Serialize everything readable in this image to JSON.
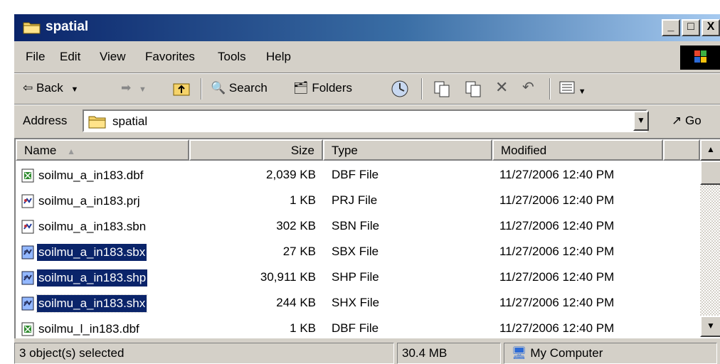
{
  "window": {
    "title": "spatial",
    "controls": {
      "minimize": "_",
      "maximize": "□",
      "close": "X"
    }
  },
  "menu": {
    "items": [
      "File",
      "Edit",
      "View",
      "Favorites",
      "Tools",
      "Help"
    ]
  },
  "toolbar": {
    "back_label": "Back",
    "search_label": "Search",
    "folders_label": "Folders"
  },
  "address": {
    "label": "Address",
    "value": "spatial",
    "go_label": "Go"
  },
  "columns": {
    "name": "Name",
    "size": "Size",
    "type": "Type",
    "modified": "Modified"
  },
  "files": [
    {
      "name": "soilmu_a_in183.dbf",
      "size": "2,039 KB",
      "type": "DBF File",
      "modified": "11/27/2006 12:40 PM",
      "selected": false,
      "icon": "dbf-file-icon"
    },
    {
      "name": "soilmu_a_in183.prj",
      "size": "1 KB",
      "type": "PRJ File",
      "modified": "11/27/2006 12:40 PM",
      "selected": false,
      "icon": "generic-file-icon"
    },
    {
      "name": "soilmu_a_in183.sbn",
      "size": "302 KB",
      "type": "SBN File",
      "modified": "11/27/2006 12:40 PM",
      "selected": false,
      "icon": "generic-file-icon"
    },
    {
      "name": "soilmu_a_in183.sbx",
      "size": "27 KB",
      "type": "SBX File",
      "modified": "11/27/2006 12:40 PM",
      "selected": true,
      "icon": "generic-file-icon"
    },
    {
      "name": "soilmu_a_in183.shp",
      "size": "30,911 KB",
      "type": "SHP File",
      "modified": "11/27/2006 12:40 PM",
      "selected": true,
      "icon": "generic-file-icon"
    },
    {
      "name": "soilmu_a_in183.shx",
      "size": "244 KB",
      "type": "SHX File",
      "modified": "11/27/2006 12:40 PM",
      "selected": true,
      "icon": "generic-file-icon"
    },
    {
      "name": "soilmu_l_in183.dbf",
      "size": "1 KB",
      "type": "DBF File",
      "modified": "11/27/2006 12:40 PM",
      "selected": false,
      "icon": "dbf-file-icon"
    }
  ],
  "status": {
    "selection": "3 object(s) selected",
    "size": "30.4 MB",
    "zone": "My Computer"
  },
  "colors": {
    "titlebar_start": "#0a246a",
    "titlebar_end": "#a6caf0",
    "selection": "#0a246a",
    "face": "#d4d0c8"
  }
}
